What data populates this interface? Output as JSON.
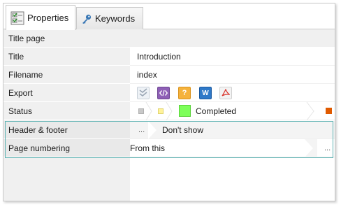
{
  "tabs": [
    {
      "label": "Properties",
      "icon": "properties-icon",
      "active": true
    },
    {
      "label": "Keywords",
      "icon": "key-icon",
      "active": false
    }
  ],
  "section": {
    "label": "Title page"
  },
  "rows": {
    "title": {
      "label": "Title",
      "value": "Introduction"
    },
    "filename": {
      "label": "Filename",
      "value": "index"
    },
    "export": {
      "label": "Export",
      "icons": [
        "checkmarks-icon",
        "code-icon",
        "help-icon",
        "word-icon",
        "pdf-icon"
      ],
      "word_letter": "W"
    },
    "status": {
      "label": "Status",
      "value": "Completed",
      "colors": [
        "#c8c8c8",
        "#fff29a",
        "#7dff5a",
        "#e05a00"
      ]
    },
    "header_footer": {
      "label": "Header & footer",
      "value": "Don't show",
      "button": "..."
    },
    "page_numbering": {
      "label": "Page numbering",
      "value": "From this",
      "button": "..."
    }
  },
  "colors": {
    "highlight_border": "#5fb3b3",
    "label_bg": "#f0f0f0"
  }
}
